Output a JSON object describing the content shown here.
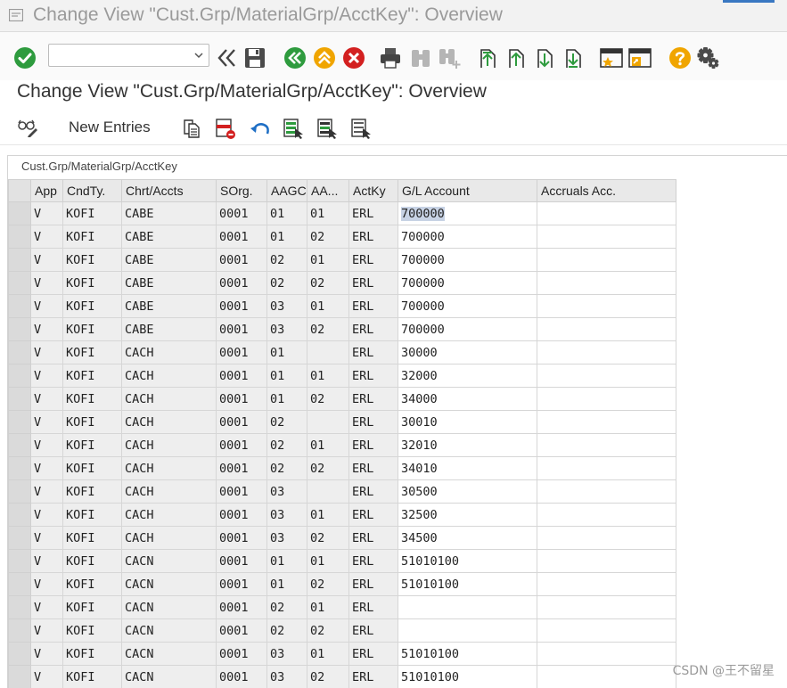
{
  "window": {
    "title": "Change View \"Cust.Grp/MaterialGrp/AcctKey\": Overview",
    "accent_color": "#3a78c2"
  },
  "toolbar": {
    "icons": [
      "check-icon",
      "command-dropdown-icon",
      "collapse-icon",
      "save-icon",
      "back-icon",
      "exit-icon",
      "cancel-icon",
      "print-icon",
      "find-icon",
      "find-next-icon",
      "first-page-icon",
      "previous-page-icon",
      "next-page-icon",
      "last-page-icon",
      "create-session-icon",
      "shortcut-icon",
      "help-icon",
      "settings-icon"
    ],
    "command_value": ""
  },
  "screen": {
    "title": "Change View \"Cust.Grp/MaterialGrp/AcctKey\": Overview"
  },
  "app_toolbar": {
    "new_entries_label": "New Entries",
    "icons": [
      "display-change-icon",
      "copy-icon",
      "delete-icon",
      "undo-icon",
      "select-all-icon",
      "select-block-icon",
      "deselect-all-icon"
    ]
  },
  "table": {
    "caption": "Cust.Grp/MaterialGrp/AcctKey",
    "columns": [
      "App",
      "CndTy.",
      "Chrt/Accts",
      "SOrg.",
      "AAGC",
      "AA...",
      "ActKy",
      "G/L Account",
      "Accruals Acc."
    ],
    "rows": [
      [
        "V",
        "KOFI",
        "CABE",
        "0001",
        "01",
        "01",
        "ERL",
        "700000",
        ""
      ],
      [
        "V",
        "KOFI",
        "CABE",
        "0001",
        "01",
        "02",
        "ERL",
        "700000",
        ""
      ],
      [
        "V",
        "KOFI",
        "CABE",
        "0001",
        "02",
        "01",
        "ERL",
        "700000",
        ""
      ],
      [
        "V",
        "KOFI",
        "CABE",
        "0001",
        "02",
        "02",
        "ERL",
        "700000",
        ""
      ],
      [
        "V",
        "KOFI",
        "CABE",
        "0001",
        "03",
        "01",
        "ERL",
        "700000",
        ""
      ],
      [
        "V",
        "KOFI",
        "CABE",
        "0001",
        "03",
        "02",
        "ERL",
        "700000",
        ""
      ],
      [
        "V",
        "KOFI",
        "CACH",
        "0001",
        "01",
        "",
        "ERL",
        "30000",
        ""
      ],
      [
        "V",
        "KOFI",
        "CACH",
        "0001",
        "01",
        "01",
        "ERL",
        "32000",
        ""
      ],
      [
        "V",
        "KOFI",
        "CACH",
        "0001",
        "01",
        "02",
        "ERL",
        "34000",
        ""
      ],
      [
        "V",
        "KOFI",
        "CACH",
        "0001",
        "02",
        "",
        "ERL",
        "30010",
        ""
      ],
      [
        "V",
        "KOFI",
        "CACH",
        "0001",
        "02",
        "01",
        "ERL",
        "32010",
        ""
      ],
      [
        "V",
        "KOFI",
        "CACH",
        "0001",
        "02",
        "02",
        "ERL",
        "34010",
        ""
      ],
      [
        "V",
        "KOFI",
        "CACH",
        "0001",
        "03",
        "",
        "ERL",
        "30500",
        ""
      ],
      [
        "V",
        "KOFI",
        "CACH",
        "0001",
        "03",
        "01",
        "ERL",
        "32500",
        ""
      ],
      [
        "V",
        "KOFI",
        "CACH",
        "0001",
        "03",
        "02",
        "ERL",
        "34500",
        ""
      ],
      [
        "V",
        "KOFI",
        "CACN",
        "0001",
        "01",
        "01",
        "ERL",
        "51010100",
        ""
      ],
      [
        "V",
        "KOFI",
        "CACN",
        "0001",
        "01",
        "02",
        "ERL",
        "51010100",
        ""
      ],
      [
        "V",
        "KOFI",
        "CACN",
        "0001",
        "02",
        "01",
        "ERL",
        "",
        ""
      ],
      [
        "V",
        "KOFI",
        "CACN",
        "0001",
        "02",
        "02",
        "ERL",
        "",
        ""
      ],
      [
        "V",
        "KOFI",
        "CACN",
        "0001",
        "03",
        "01",
        "ERL",
        "51010100",
        ""
      ],
      [
        "V",
        "KOFI",
        "CACN",
        "0001",
        "03",
        "02",
        "ERL",
        "51010100",
        ""
      ]
    ],
    "highlighted_cell": {
      "row": 0,
      "column": 7
    }
  },
  "watermark": "CSDN @王不留星"
}
